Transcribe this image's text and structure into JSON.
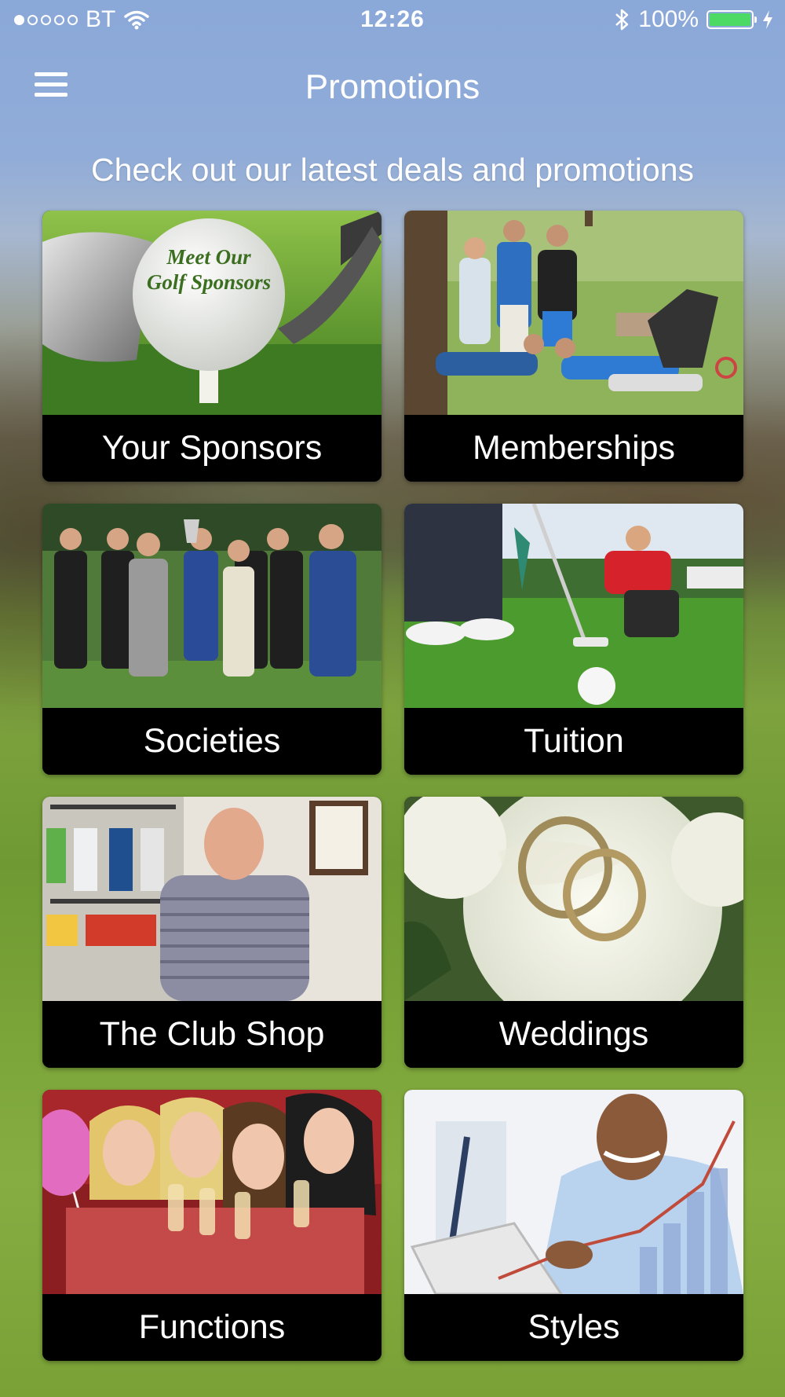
{
  "status_bar": {
    "carrier": "BT",
    "signal_bars_filled": 1,
    "signal_bars_total": 5,
    "time": "12:26",
    "battery": "100%",
    "battery_level": 1.0,
    "icons": [
      "wifi-icon",
      "bluetooth-icon",
      "battery-icon",
      "charging-bolt-icon"
    ]
  },
  "nav": {
    "title": "Promotions",
    "menu_icon": "hamburger-menu-icon"
  },
  "subtitle": "Check out our latest deals and promotions",
  "tiles": [
    {
      "label": "Your Sponsors",
      "ball_text_1": "Meet Our",
      "ball_text_2": "Golf Sponsors"
    },
    {
      "label": "Memberships"
    },
    {
      "label": "Societies"
    },
    {
      "label": "Tuition"
    },
    {
      "label": "The Club Shop"
    },
    {
      "label": "Weddings"
    },
    {
      "label": "Functions"
    },
    {
      "label": "Styles"
    }
  ],
  "colors": {
    "sky": "#8aa8d8",
    "grass": "#7aa438",
    "tile_label_bg": "#000000",
    "battery_fill": "#4cd964"
  }
}
